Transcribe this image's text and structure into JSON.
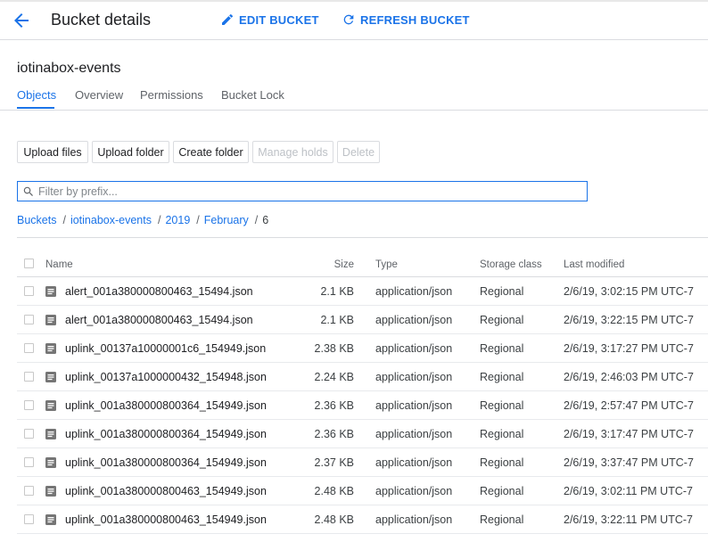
{
  "header": {
    "title": "Bucket details",
    "edit_label": "EDIT BUCKET",
    "refresh_label": "REFRESH BUCKET"
  },
  "bucket_name": "iotinabox-events",
  "tabs": [
    {
      "label": "Objects",
      "active": true
    },
    {
      "label": "Overview",
      "active": false
    },
    {
      "label": "Permissions",
      "active": false
    },
    {
      "label": "Bucket Lock",
      "active": false
    }
  ],
  "toolbar": {
    "upload_files": "Upload files",
    "upload_folder": "Upload folder",
    "create_folder": "Create folder",
    "manage_holds": "Manage holds",
    "delete": "Delete"
  },
  "filter": {
    "placeholder": "Filter by prefix...",
    "value": ""
  },
  "breadcrumb": {
    "items": [
      "Buckets",
      "iotinabox-events",
      "2019",
      "February"
    ],
    "current": "6"
  },
  "table": {
    "columns": {
      "name": "Name",
      "size": "Size",
      "type": "Type",
      "storage_class": "Storage class",
      "last_modified": "Last modified"
    },
    "rows": [
      {
        "name": "alert_001a380000800463_15494.json",
        "size": "2.1 KB",
        "type": "application/json",
        "storage_class": "Regional",
        "last_modified": "2/6/19, 3:02:15 PM UTC-7"
      },
      {
        "name": "alert_001a380000800463_15494.json",
        "size": "2.1 KB",
        "type": "application/json",
        "storage_class": "Regional",
        "last_modified": "2/6/19, 3:22:15 PM UTC-7"
      },
      {
        "name": "uplink_00137a10000001c6_154949.json",
        "size": "2.38 KB",
        "type": "application/json",
        "storage_class": "Regional",
        "last_modified": "2/6/19, 3:17:27 PM UTC-7"
      },
      {
        "name": "uplink_00137a1000000432_154948.json",
        "size": "2.24 KB",
        "type": "application/json",
        "storage_class": "Regional",
        "last_modified": "2/6/19, 2:46:03 PM UTC-7"
      },
      {
        "name": "uplink_001a380000800364_154949.json",
        "size": "2.36 KB",
        "type": "application/json",
        "storage_class": "Regional",
        "last_modified": "2/6/19, 2:57:47 PM UTC-7"
      },
      {
        "name": "uplink_001a380000800364_154949.json",
        "size": "2.36 KB",
        "type": "application/json",
        "storage_class": "Regional",
        "last_modified": "2/6/19, 3:17:47 PM UTC-7"
      },
      {
        "name": "uplink_001a380000800364_154949.json",
        "size": "2.37 KB",
        "type": "application/json",
        "storage_class": "Regional",
        "last_modified": "2/6/19, 3:37:47 PM UTC-7"
      },
      {
        "name": "uplink_001a380000800463_154949.json",
        "size": "2.48 KB",
        "type": "application/json",
        "storage_class": "Regional",
        "last_modified": "2/6/19, 3:02:11 PM UTC-7"
      },
      {
        "name": "uplink_001a380000800463_154949.json",
        "size": "2.48 KB",
        "type": "application/json",
        "storage_class": "Regional",
        "last_modified": "2/6/19, 3:22:11 PM UTC-7"
      }
    ]
  },
  "icons": {
    "back": "arrow-left-icon",
    "edit": "pencil-icon",
    "refresh": "refresh-icon",
    "search": "search-icon",
    "file": "file-text-icon"
  },
  "colors": {
    "accent": "#1a73e8",
    "text": "#202124",
    "muted": "#5f6368",
    "border": "#dadce0",
    "disabled": "#bdc1c6"
  }
}
